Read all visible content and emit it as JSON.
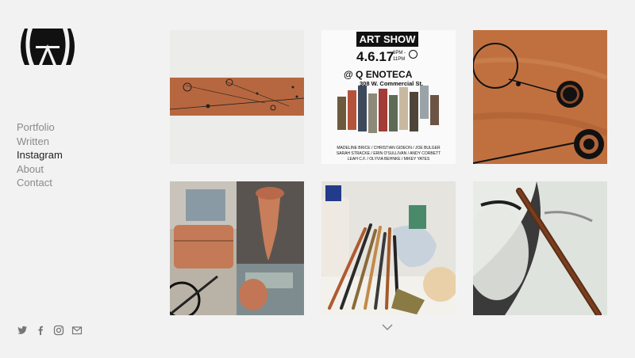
{
  "nav": {
    "items": [
      {
        "label": "Portfolio",
        "active": false
      },
      {
        "label": "Written",
        "active": false
      },
      {
        "label": "Instagram",
        "active": true
      },
      {
        "label": "About",
        "active": false
      },
      {
        "label": "Contact",
        "active": false
      }
    ]
  },
  "social": [
    "twitter-icon",
    "facebook-icon",
    "instagram-icon",
    "mail-icon"
  ],
  "poster": {
    "title": "ART SHOW",
    "date": "4.6.17",
    "time_top": "6PM -",
    "time_bottom": "11PM",
    "venue": "@ Q ENOTECA",
    "address": "308 W. Commercial St.",
    "artists": [
      "MADELINE BRICE / CHRISTIAN GIDEON / JOE BULGER",
      "SARAH STRACKE / ERIN O'SULLIVAN / ANDY CORBETT",
      "LEAH C.F. / OLYVIA BEHNKE / MIKEY YATES"
    ]
  },
  "colors": {
    "background": "#f2f2f2",
    "nav_active": "#222222",
    "nav_inactive": "#8a8a8a",
    "wood": "#b8643a"
  },
  "icons": {
    "logo": "logo-mark",
    "scroll": "chevron-down-icon"
  }
}
